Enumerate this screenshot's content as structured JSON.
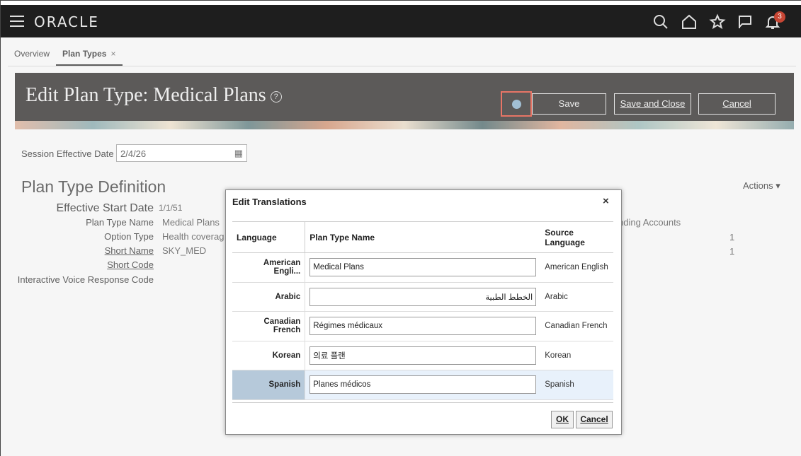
{
  "header": {
    "brand": "ORACLE",
    "notification_count": "3",
    "icons": [
      "search-icon",
      "home-icon",
      "star-icon",
      "flag-icon",
      "bell-icon"
    ]
  },
  "tabs": [
    {
      "label": "Overview"
    },
    {
      "label": "Plan Types",
      "close": "×"
    }
  ],
  "banner": {
    "title": "Edit Plan Type: Medical Plans",
    "help": "?",
    "save": "Save",
    "save_close": "Save and Close",
    "cancel": "Cancel"
  },
  "session": {
    "label": "Session Effective Date",
    "value": "2/4/26"
  },
  "definition": {
    "title": "Plan Type Definition",
    "actions": "Actions ▾",
    "fields": [
      {
        "label": "Effective Start Date",
        "value": "1/1/51"
      },
      {
        "label": "Plan Type Name",
        "value": "Medical Plans"
      },
      {
        "label": "Option Type",
        "value": "Health coverag"
      },
      {
        "label": "Short Name",
        "value": "SKY_MED"
      },
      {
        "label": "Short Code",
        "value": ""
      },
      {
        "label": "Interactive Voice Response Code",
        "value": ""
      }
    ],
    "right_text": "nding Accounts",
    "right_val1": "1",
    "right_val2": "1"
  },
  "dialog": {
    "title": "Edit Translations",
    "close": "×",
    "columns": [
      "Language",
      "Plan Type Name",
      "Source Language"
    ],
    "rows": [
      {
        "language": "American Engli...",
        "name": "Medical Plans",
        "source": "American English"
      },
      {
        "language": "Arabic",
        "name": "الخطط الطبية",
        "source": "Arabic"
      },
      {
        "language": "Canadian French",
        "name": "Régimes médicaux",
        "source": "Canadian French"
      },
      {
        "language": "Korean",
        "name": "의료 플랜",
        "source": "Korean"
      },
      {
        "language": "Spanish",
        "name": "Planes médicos",
        "source": "Spanish"
      }
    ],
    "ok": "OK",
    "cancel": "Cancel"
  },
  "colors": {
    "header_bg": "#1e1e1e",
    "badge": "#c74634",
    "highlight_box": "#e0402c",
    "selected_row": "#e8f1fb"
  }
}
